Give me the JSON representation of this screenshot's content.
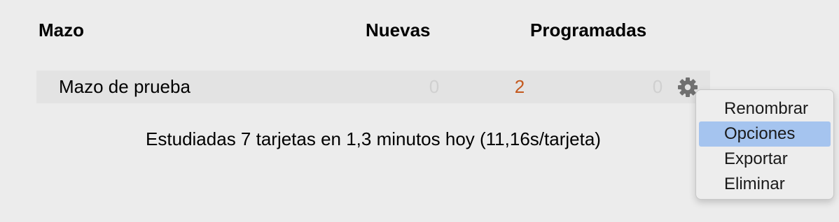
{
  "header": {
    "deck": "Mazo",
    "new": "Nuevas",
    "due": "Programadas"
  },
  "deck": {
    "name": "Mazo de prueba",
    "new_count": "0",
    "learn_count": "2",
    "due_count": "0",
    "options_icon": "gear-icon"
  },
  "stats": {
    "text": "Estudiadas 7 tarjetas en 1,3 minutos hoy (11,16s/tarjeta)"
  },
  "context_menu": {
    "items": [
      {
        "label": "Renombrar",
        "selected": false
      },
      {
        "label": "Opciones",
        "selected": true
      },
      {
        "label": "Exportar",
        "selected": false
      },
      {
        "label": "Eliminar",
        "selected": false
      }
    ]
  },
  "colors": {
    "background": "#ececec",
    "row_background": "#e3e3e3",
    "learn_count": "#c4591e",
    "zero_count": "#d0d0d0",
    "menu_highlight": "#a5c4ef"
  }
}
